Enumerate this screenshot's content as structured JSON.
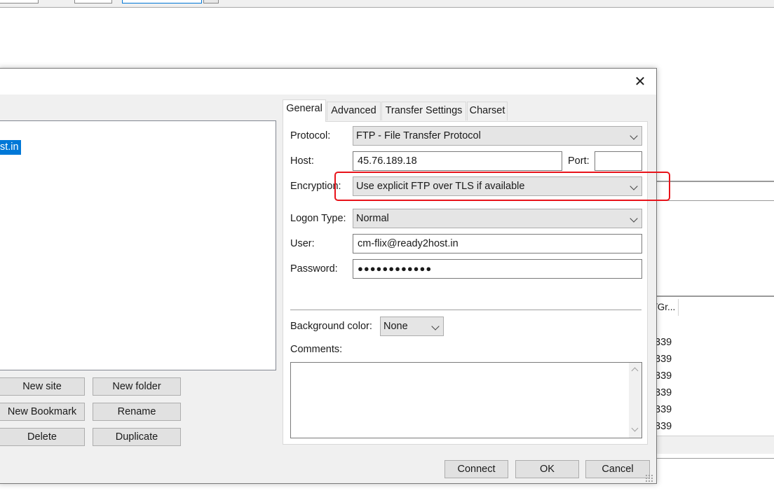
{
  "background": {
    "column_header": "/Gr...",
    "row_values": [
      "339",
      "339",
      "339",
      "339",
      "339",
      "339"
    ]
  },
  "dialog": {
    "close_glyph": "✕",
    "site_tree": {
      "selected_item": "st.in"
    },
    "buttons": {
      "new_site": "New site",
      "new_folder": "New folder",
      "new_bookmark": "New Bookmark",
      "rename": "Rename",
      "delete": "Delete",
      "duplicate": "Duplicate"
    },
    "tabs": [
      {
        "label": "General",
        "active": true
      },
      {
        "label": "Advanced",
        "active": false
      },
      {
        "label": "Transfer Settings",
        "active": false
      },
      {
        "label": "Charset",
        "active": false
      }
    ],
    "general": {
      "protocol_label": "Protocol:",
      "protocol_value": "FTP - File Transfer Protocol",
      "host_label": "Host:",
      "host_value": "45.76.189.18",
      "port_label": "Port:",
      "port_value": "",
      "encryption_label": "Encryption:",
      "encryption_value": "Use explicit FTP over TLS if available",
      "logon_type_label": "Logon Type:",
      "logon_type_value": "Normal",
      "user_label": "User:",
      "user_value": "cm-flix@ready2host.in",
      "password_label": "Password:",
      "password_value": "●●●●●●●●●●●●",
      "bg_color_label": "Background color:",
      "bg_color_value": "None",
      "comments_label": "Comments:",
      "comments_value": ""
    },
    "footer": {
      "connect": "Connect",
      "ok": "OK",
      "cancel": "Cancel"
    },
    "highlight_color": "#e8131a",
    "selection_color": "#0078d7"
  }
}
